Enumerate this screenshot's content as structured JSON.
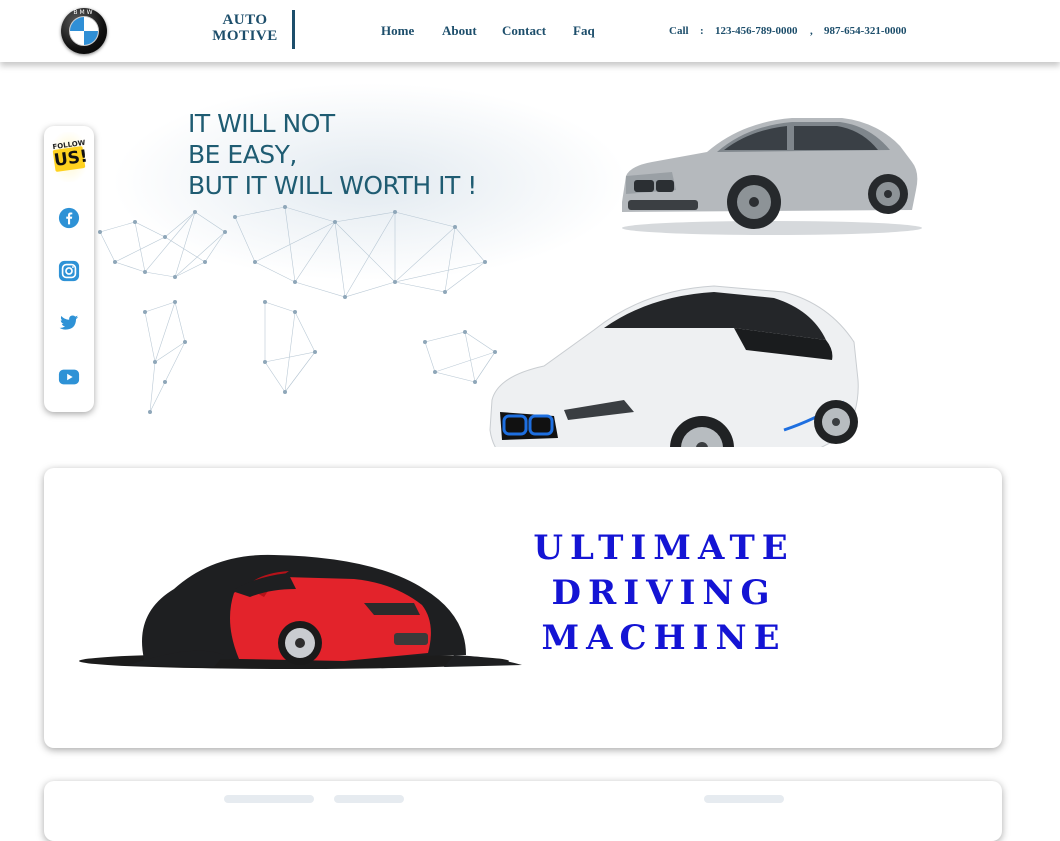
{
  "header": {
    "logo_text": "BMW",
    "brand_line1": "AUTO",
    "brand_line2": "MOTIVE",
    "nav": [
      "Home",
      "About",
      "Contact",
      "Faq"
    ],
    "call_label": "Call",
    "call_colon": ":",
    "phones": [
      "123-456-789-0000",
      "987-654-321-0000"
    ],
    "phone_separator": ","
  },
  "hero": {
    "headline": [
      "IT WILL NOT",
      "BE EASY,",
      "BUT IT WILL WORTH IT  !"
    ]
  },
  "follow": {
    "small_text": "FOLLOW",
    "big_text": "US!",
    "icons": [
      "facebook-icon",
      "instagram-icon",
      "twitter-icon",
      "youtube-icon"
    ],
    "icon_color": "#2e92d6"
  },
  "feature": {
    "slogan": [
      "ULTIMATE",
      "DRIVING",
      "MACHINE"
    ],
    "slogan_color": "#1414d4"
  },
  "colors": {
    "brand": "#1d4e6b",
    "headline": "#1f5c72"
  }
}
